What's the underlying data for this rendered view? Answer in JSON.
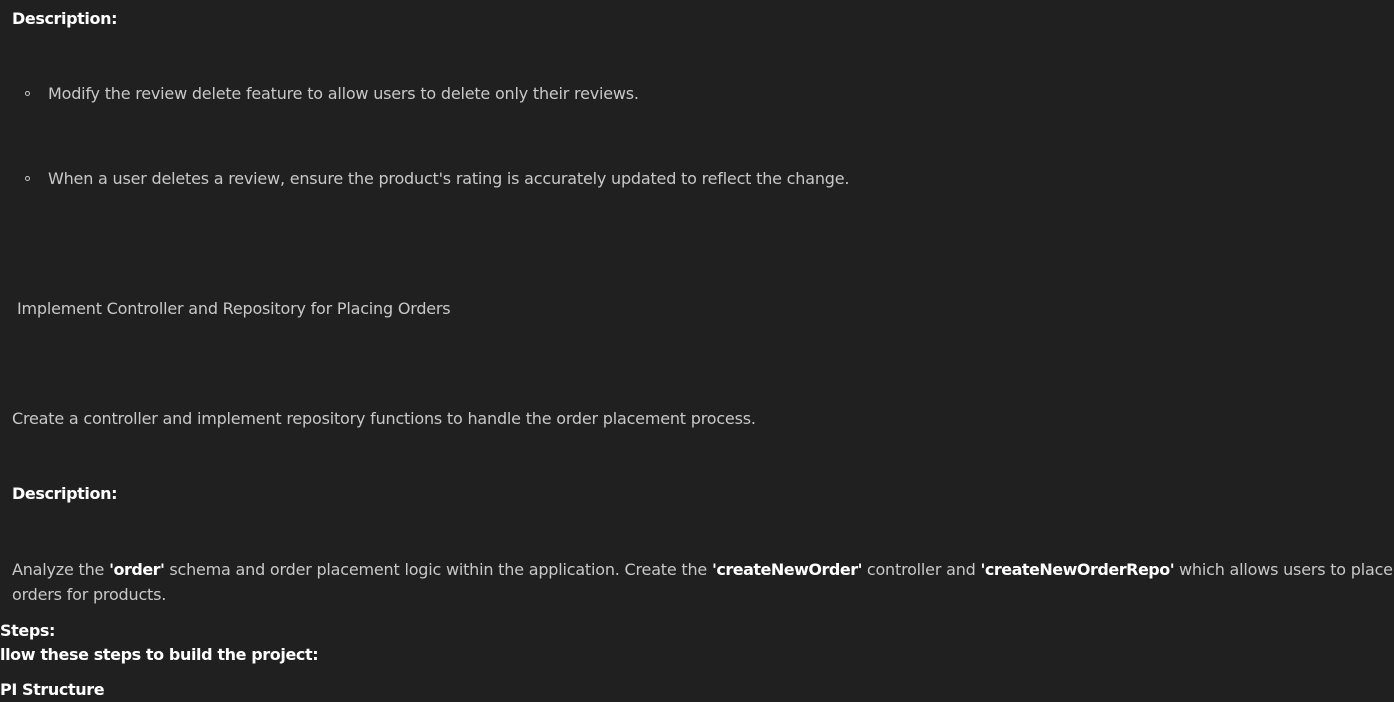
{
  "section1": {
    "description_heading": "Description:",
    "bullets": [
      "Modify the review delete feature to allow users to delete only their reviews.",
      "When a user deletes a review, ensure the product's rating is accurately updated to reflect the change."
    ]
  },
  "section2": {
    "title": "Implement Controller and Repository for Placing Orders",
    "summary": "Create a controller and implement repository functions to handle the order placement process.",
    "description_heading": "Description:",
    "description": {
      "part1": "Analyze the ",
      "strong1": "'order'",
      "part2": " schema and order placement logic within the application. Create the ",
      "strong2": "'createNewOrder'",
      "part3": " controller and ",
      "strong3": "'createNewOrderRepo'",
      "part4": " which allows users to place orders for products."
    }
  },
  "steps": {
    "heading": "Steps:",
    "intro": "llow these steps to build the project:",
    "subheading": "PI Structure"
  }
}
